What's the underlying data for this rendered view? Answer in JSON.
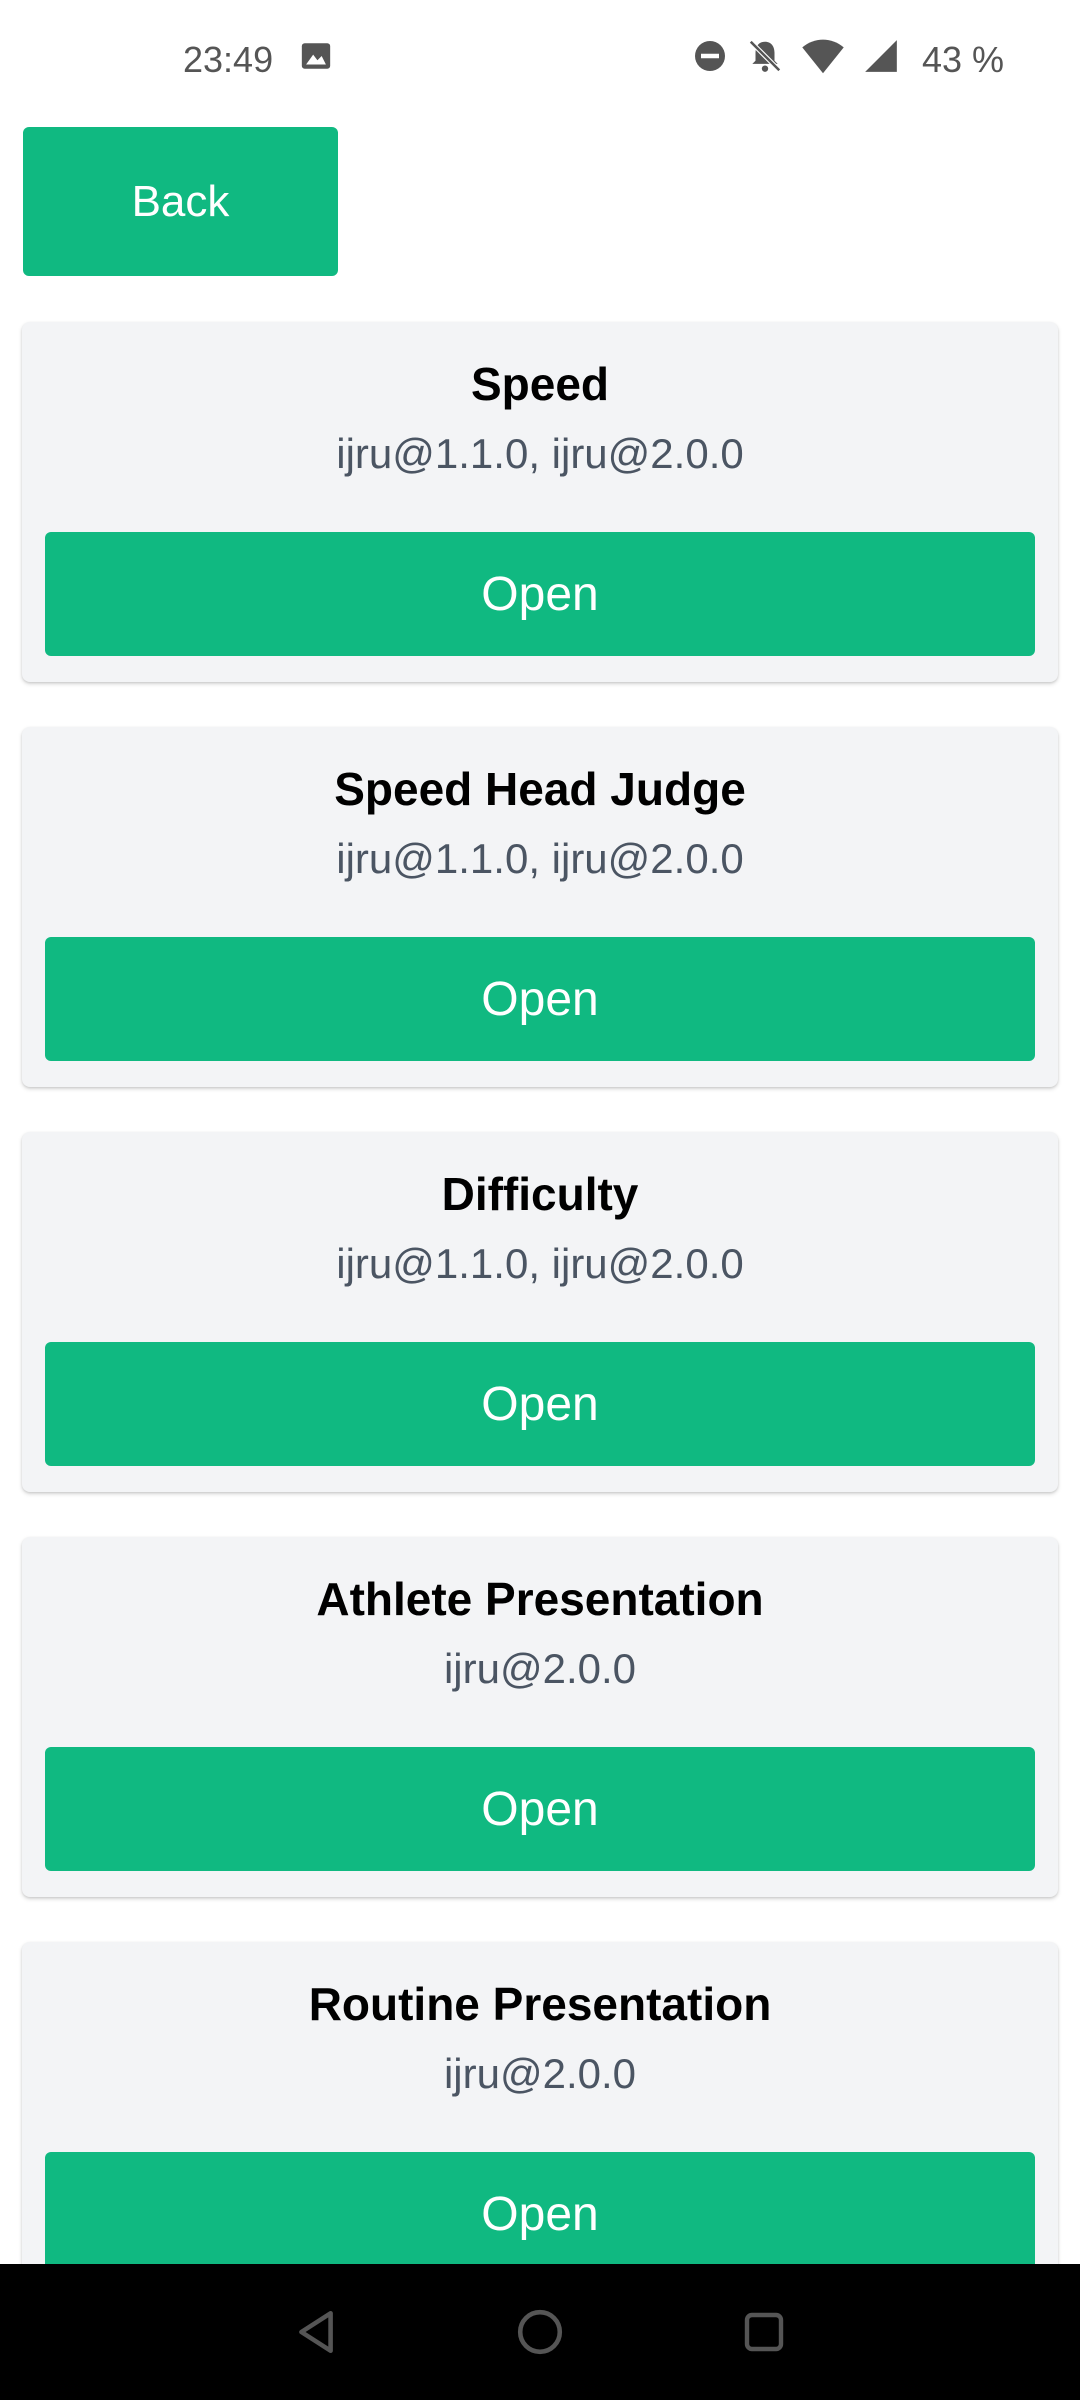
{
  "status_bar": {
    "time": "23:49",
    "battery": "43 %",
    "icons": [
      "image-icon",
      "dnd-icon",
      "bell-off-icon",
      "wifi-icon",
      "signal-icon"
    ]
  },
  "back_button": {
    "label": "Back"
  },
  "cards": [
    {
      "title": "Speed",
      "versions": "ijru@1.1.0, ijru@2.0.0",
      "button": "Open"
    },
    {
      "title": "Speed Head Judge",
      "versions": "ijru@1.1.0, ijru@2.0.0",
      "button": "Open"
    },
    {
      "title": "Difficulty",
      "versions": "ijru@1.1.0, ijru@2.0.0",
      "button": "Open"
    },
    {
      "title": "Athlete Presentation",
      "versions": "ijru@2.0.0",
      "button": "Open"
    },
    {
      "title": "Routine Presentation",
      "versions": "ijru@2.0.0",
      "button": "Open"
    }
  ],
  "nav_bar": {
    "icons": [
      "back-triangle-icon",
      "home-circle-icon",
      "recents-square-icon"
    ]
  },
  "colors": {
    "accent": "#10b981",
    "card_bg": "#f3f4f6",
    "muted_text": "#4b5563"
  }
}
